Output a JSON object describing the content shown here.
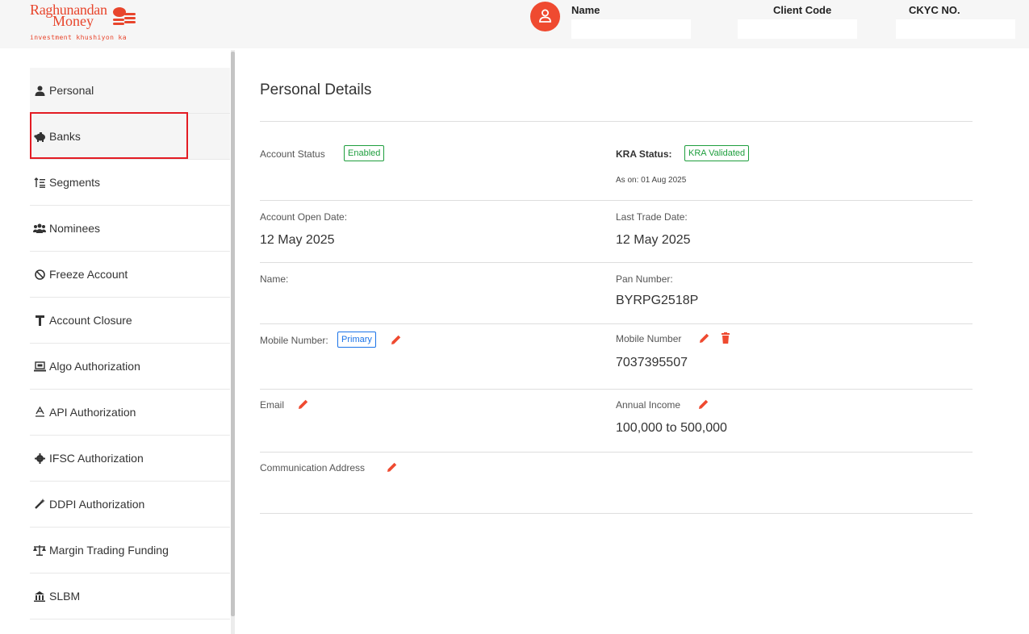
{
  "header": {
    "logo": {
      "line1": "Raghunandan",
      "line2": "Money",
      "tagline": "investment khushiyon ka"
    },
    "name_label": "Name",
    "client_code_label": "Client Code",
    "ckyc_label": "CKYC NO.",
    "name_value": "",
    "client_code_value": "",
    "ckyc_value": ""
  },
  "sidebar": {
    "items": [
      {
        "label": "Personal",
        "icon": "user-icon"
      },
      {
        "label": "Banks",
        "icon": "piggy-bank-icon"
      },
      {
        "label": "Segments",
        "icon": "sort-icon"
      },
      {
        "label": "Nominees",
        "icon": "users-icon"
      },
      {
        "label": "Freeze Account",
        "icon": "ban-icon"
      },
      {
        "label": "Account Closure",
        "icon": "person-dolly-icon"
      },
      {
        "label": "Algo Authorization",
        "icon": "laptop-code-icon"
      },
      {
        "label": "API Authorization",
        "icon": "text-icon"
      },
      {
        "label": "IFSC Authorization",
        "icon": "gear-icon"
      },
      {
        "label": "DDPI Authorization",
        "icon": "wand-icon"
      },
      {
        "label": "Margin Trading Funding",
        "icon": "scale-icon"
      },
      {
        "label": "SLBM",
        "icon": "building-icon"
      }
    ]
  },
  "main": {
    "title": "Personal Details",
    "account_status": {
      "label": "Account Status",
      "badge": "Enabled"
    },
    "kra_status": {
      "label": "KRA Status:",
      "badge": "KRA Validated",
      "as_on": "As on: 01 Aug 2025"
    },
    "account_open_date": {
      "label": "Account Open Date:",
      "value": "12 May 2025"
    },
    "last_trade_date": {
      "label": "Last Trade Date:",
      "value": "12 May 2025"
    },
    "name": {
      "label": "Name:",
      "value": ""
    },
    "pan": {
      "label": "Pan Number:",
      "value": "BYRPG2518P"
    },
    "mobile_primary": {
      "label": "Mobile Number:",
      "badge": "Primary"
    },
    "mobile_secondary": {
      "label": "Mobile Number",
      "value": "7037395507"
    },
    "email": {
      "label": "Email",
      "value": ""
    },
    "annual_income": {
      "label": "Annual Income",
      "value": "100,000 to 500,000"
    },
    "communication_address": {
      "label": "Communication Address",
      "value": ""
    }
  },
  "colors": {
    "brand": "#e8452c",
    "success": "#1e9e3d",
    "primary": "#1a73e8",
    "highlight": "#e31b23"
  }
}
